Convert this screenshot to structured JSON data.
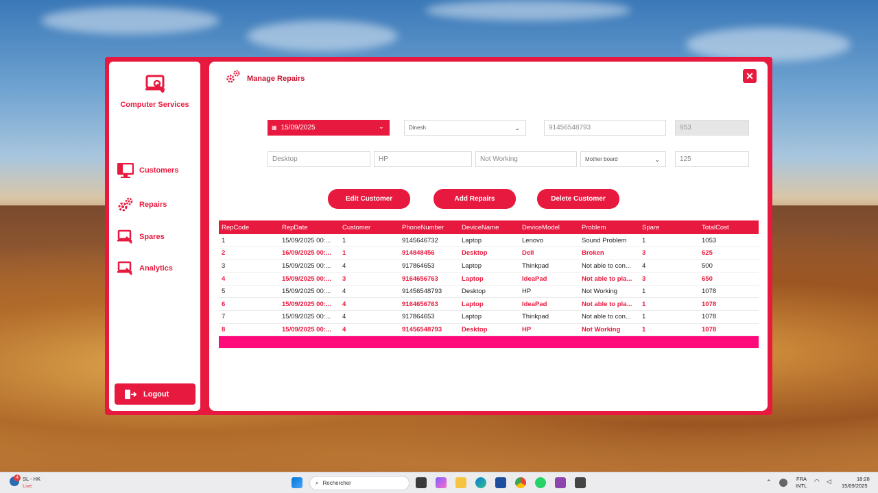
{
  "app": {
    "brand_title": "Computer Services",
    "page_title": "Manage Repairs",
    "accent": "#e8193e"
  },
  "sidebar": {
    "items": [
      {
        "label": "Customers",
        "icon": "monitor-icon"
      },
      {
        "label": "Repairs",
        "icon": "gears-icon"
      },
      {
        "label": "Spares",
        "icon": "laptop-wrench-icon"
      },
      {
        "label": "Analytics",
        "icon": "laptop-wrench-icon"
      }
    ],
    "logout_label": "Logout"
  },
  "form": {
    "date_value": "15/09/2025",
    "customer_value": "Dinesh",
    "phone_value": "91456548793",
    "repcode_value": "953",
    "device_name_value": "Desktop",
    "device_model_value": "HP",
    "problem_value": "Not Working",
    "spare_value": "Mother board",
    "cost_value": "125"
  },
  "buttons": {
    "edit": "Edit Customer",
    "add": "Add Repairs",
    "delete": "Delete Customer"
  },
  "table": {
    "columns": [
      "RepCode",
      "RepDate",
      "Customer",
      "PhoneNumber",
      "DeviceName",
      "DeviceModel",
      "Problem",
      "Spare",
      "TotalCost"
    ],
    "rows": [
      [
        "1",
        "15/09/2025 00:...",
        "1",
        "9145646732",
        "Laptop",
        "Lenovo",
        "Sound Problem",
        "1",
        "1053"
      ],
      [
        "2",
        "16/09/2025 00:...",
        "1",
        "914848456",
        "Desktop",
        "Dell",
        "Broken",
        "3",
        "625"
      ],
      [
        "3",
        "15/09/2025 00:...",
        "4",
        "917864653",
        "Laptop",
        "Thinkpad",
        "Not able to con...",
        "4",
        "500"
      ],
      [
        "4",
        "15/09/2025 00:...",
        "3",
        "9164656763",
        "Laptop",
        "IdeaPad",
        "Not able to pla...",
        "3",
        "650"
      ],
      [
        "5",
        "15/09/2025 00:...",
        "4",
        "91456548793",
        "Desktop",
        "HP",
        "Not Working",
        "1",
        "1078"
      ],
      [
        "6",
        "15/09/2025 00:...",
        "4",
        "9164656763",
        "Laptop",
        "IdeaPad",
        "Not able to pla...",
        "1",
        "1078"
      ],
      [
        "7",
        "15/09/2025 00:...",
        "4",
        "917864653",
        "Laptop",
        "Thinkpad",
        "Not able to con...",
        "1",
        "1078"
      ],
      [
        "8",
        "15/09/2025 00:...",
        "4",
        "91456548793",
        "Desktop",
        "HP",
        "Not Working",
        "1",
        "1078"
      ]
    ]
  },
  "taskbar": {
    "weather": "SL - HK",
    "weather_status": "Live",
    "weather_badge": "4",
    "search_placeholder": "Rechercher",
    "lang_1": "FRA",
    "lang_2": "INTL",
    "time": "18:28",
    "date": "15/09/2025"
  }
}
